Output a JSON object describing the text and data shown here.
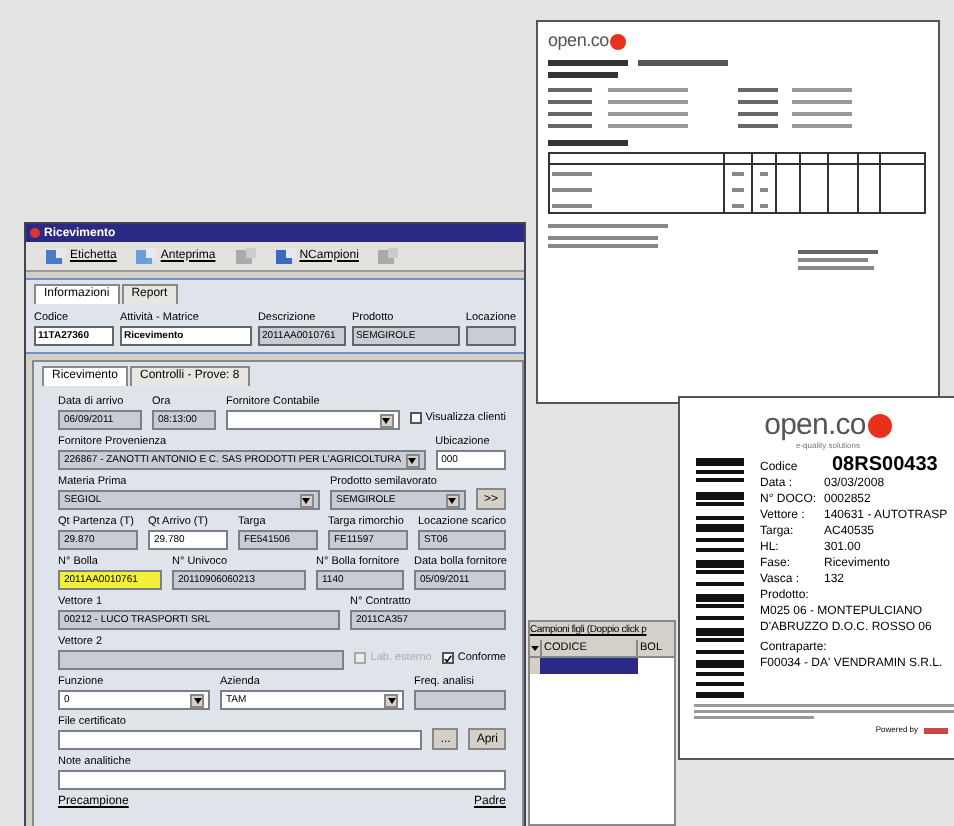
{
  "window": {
    "title": "Ricevimento"
  },
  "toolbar": [
    {
      "label": "Etichetta",
      "disabled": false
    },
    {
      "label": "Anteprima",
      "disabled": false
    },
    {
      "disabled": true
    },
    {
      "label": "NCampioni",
      "disabled": false
    },
    {
      "disabled": true
    }
  ],
  "tabs": [
    {
      "label": "Informazioni",
      "selected": true
    },
    {
      "label": "Report",
      "selected": false
    }
  ],
  "header_fields": [
    {
      "label": "Codice",
      "value": "11TA27360"
    },
    {
      "label": "Attività - Matrice",
      "value": "Ricevimento"
    },
    {
      "label": "Descrizione",
      "value": "2011AA0010761"
    },
    {
      "label": "Prodotto",
      "value": "SEMGIROLE"
    },
    {
      "label": "Locazione"
    }
  ],
  "inner_tabs": [
    {
      "label": "Ricevimento",
      "selected": true
    },
    {
      "label": "Controlli - Prove: 8",
      "selected": false
    }
  ],
  "form": {
    "rows": [
      {
        "items": [
          {
            "kind": "field",
            "label": "Data di arrivo",
            "value": "06/09/2011",
            "dropdown": false
          },
          {
            "kind": "field",
            "label": "Ora",
            "value": "08:13:00",
            "dropdown": false
          },
          {
            "kind": "field",
            "label": "Fornitore Contabile",
            "dropdown": true
          },
          {
            "kind": "checkbox",
            "label": "Visualizza clienti",
            "checked": false,
            "disabled": false
          }
        ]
      },
      {
        "items": [
          {
            "kind": "field",
            "label": "Fornitore Provenienza",
            "value": "226867 - ZANOTTI ANTONIO E C. SAS PRODOTTI PER L'AGRICOLTURA",
            "dropdown": true
          },
          {
            "kind": "field",
            "label": "Ubicazione",
            "value": "000",
            "dropdown": false
          }
        ]
      },
      {
        "items": [
          {
            "kind": "field",
            "label": "Materia Prima",
            "value": "SEGIOL",
            "dropdown": true
          },
          {
            "kind": "field",
            "label": "Prodotto semilavorato",
            "value": "SEMGIROLE",
            "dropdown": true
          },
          {
            "kind": "button",
            "label": ">>"
          }
        ]
      },
      {
        "items": [
          {
            "kind": "field",
            "label": "Qt Partenza (T)",
            "value": "29.870",
            "dropdown": false
          },
          {
            "kind": "field",
            "label": "Qt Arrivo (T)",
            "value": "29.780",
            "dropdown": false
          },
          {
            "kind": "field",
            "label": "Targa",
            "value": "FE541506",
            "dropdown": false
          },
          {
            "kind": "field",
            "label": "Targa rimorchio",
            "value": "FE11597",
            "dropdown": false
          },
          {
            "kind": "field",
            "label": "Locazione scarico",
            "value": "ST06",
            "dropdown": false
          }
        ]
      },
      {
        "items": [
          {
            "kind": "field",
            "label": "N° Bolla",
            "value": "2011AA0010761",
            "dropdown": false
          },
          {
            "kind": "field",
            "label": "N° Univoco",
            "value": "20110906060213",
            "dropdown": false
          },
          {
            "kind": "field",
            "label": "N° Bolla fornitore",
            "value": "1140",
            "dropdown": false
          },
          {
            "kind": "field",
            "label": "Data bolla fornitore",
            "value": "05/09/2011",
            "dropdown": false
          }
        ]
      },
      {
        "items": [
          {
            "kind": "field",
            "label": "Vettore 1",
            "value": "00212 - LUCO TRASPORTI SRL",
            "dropdown": false
          },
          {
            "kind": "field",
            "label": "N° Contratto",
            "value": "2011CA357",
            "dropdown": false
          }
        ]
      },
      {
        "items": [
          {
            "kind": "field",
            "label": "Vettore 2",
            "dropdown": false
          },
          {
            "kind": "checkbox",
            "label": "Lab. esterno",
            "checked": false,
            "disabled": true
          },
          {
            "kind": "checkbox",
            "label": "Conforme",
            "checked": true,
            "disabled": false
          }
        ]
      },
      {
        "items": [
          {
            "kind": "field",
            "label": "Funzione",
            "value": "0",
            "dropdown": true
          },
          {
            "kind": "field",
            "label": "Azienda",
            "value": "TAM",
            "dropdown": true
          },
          {
            "kind": "field",
            "label": "Freq. analisi",
            "dropdown": false
          }
        ]
      },
      {
        "items": [
          {
            "kind": "field",
            "label": "File certificato",
            "dropdown": false
          },
          {
            "kind": "button",
            "label": "..."
          },
          {
            "kind": "button",
            "label": "Apri"
          }
        ]
      },
      {
        "items": [
          {
            "kind": "field",
            "label": "Note analitiche",
            "dropdown": false
          }
        ]
      },
      {
        "items": [
          {
            "kind": "label",
            "label": "Precampione"
          },
          {
            "kind": "label",
            "label": "Padre"
          }
        ]
      }
    ]
  },
  "samples_panel": {
    "title": "Campioni figli (Doppio click p",
    "columns": [
      "CODICE",
      "BOL"
    ]
  },
  "certificate": {
    "logo": "open.co"
  },
  "label_sheet": {
    "logo": "open.co",
    "tagline": "e-quality solutions",
    "code_label": "Codice",
    "code": "08RS00433",
    "details": [
      {
        "label": "Data :",
        "value": "03/03/2008"
      },
      {
        "label": "N° DOCO:",
        "value": "0002852"
      },
      {
        "label": "Vettore :",
        "value": "140631 - AUTOTRASP"
      },
      {
        "label": "Targa:",
        "value": "AC40535"
      },
      {
        "label": "HL:",
        "value": "301.00"
      },
      {
        "label": "Fase:",
        "value": "Ricevimento"
      },
      {
        "label": "Vasca :",
        "value": "132"
      }
    ],
    "product_label": "Prodotto:",
    "product": "M025 06 - MONTEPULCIANO D'ABRUZZO D.O.C. ROSSO 06",
    "party_label": "Contraparte:",
    "party": "F00034 - DA' VENDRAMIN S.R.L.",
    "powered": "Powered by"
  }
}
